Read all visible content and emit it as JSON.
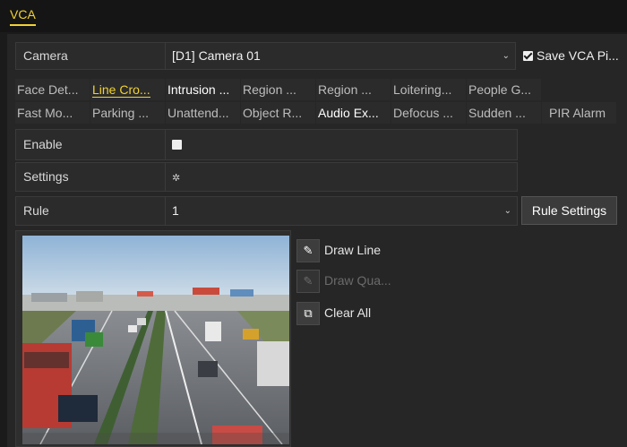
{
  "tabs": {
    "vca": "VCA"
  },
  "camera": {
    "label": "Camera",
    "value": "[D1] Camera 01",
    "arrow": "⌄"
  },
  "save_vca": {
    "label": "Save VCA Pi...",
    "checked": true
  },
  "function_tabs": [
    "Face Det...",
    "Line Cro...",
    "Intrusion ...",
    "Region ...",
    "Region ...",
    "Loitering...",
    "People G...",
    "Fast Mo...",
    "Parking ...",
    "Unattend...",
    "Object R...",
    "Audio Ex...",
    "Defocus ...",
    "Sudden ...",
    "PIR Alarm"
  ],
  "active_tab": "Line Cro...",
  "enable": {
    "label": "Enable",
    "checked": false
  },
  "settings": {
    "label": "Settings",
    "icon": "gear-icon"
  },
  "rule": {
    "label": "Rule",
    "value": "1",
    "arrow": "⌄"
  },
  "rule_settings_button": "Rule Settings",
  "tools": {
    "draw_line": {
      "label": "Draw Line",
      "icon": "pencil-icon"
    },
    "draw_quad": {
      "label": "Draw Qua...",
      "icon": "quad-edit-icon"
    },
    "clear_all": {
      "label": "Clear All",
      "icon": "clear-all-icon"
    }
  },
  "colors": {
    "accent": "#f2d231",
    "background": "#1b1b1b",
    "panel": "#262626"
  }
}
